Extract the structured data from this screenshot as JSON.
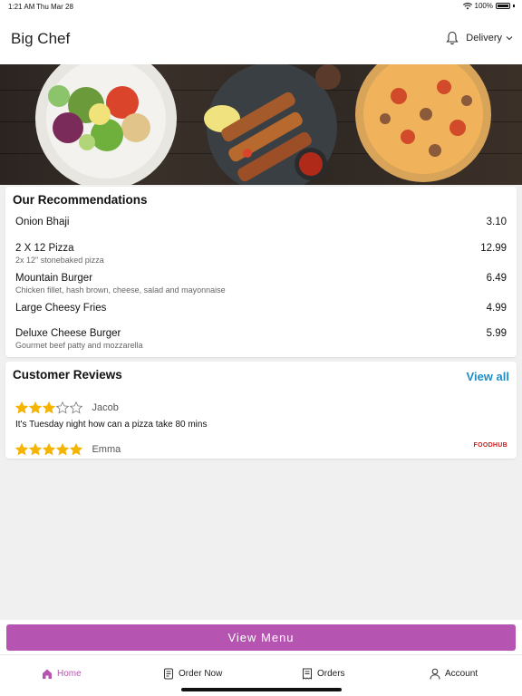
{
  "status_bar": {
    "time": "1:21 AM",
    "date": "Thu Mar 28",
    "battery": "100%"
  },
  "header": {
    "title": "Big Chef",
    "mode_label": "Delivery"
  },
  "recommendations": {
    "title": "Our Recommendations",
    "items": [
      {
        "name": "Onion Bhaji",
        "description": "",
        "price": "3.10"
      },
      {
        "name": "2 X 12 Pizza",
        "description": "2x 12\" stonebaked pizza",
        "price": "12.99"
      },
      {
        "name": "Mountain Burger",
        "description": "Chicken fillet, hash brown, cheese, salad and mayonnaise",
        "price": "6.49"
      },
      {
        "name": "Large Cheesy Fries",
        "description": "",
        "price": "4.99"
      },
      {
        "name": "Deluxe Cheese Burger",
        "description": "Gourmet beef patty and mozzarella",
        "price": "5.99"
      }
    ]
  },
  "reviews": {
    "title": "Customer Reviews",
    "view_all_label": "View all",
    "items": [
      {
        "name": "Jacob",
        "rating": 3,
        "max_rating": 5,
        "text": "It's Tuesday night how can a pizza take 80 mins"
      },
      {
        "name": "Emma",
        "rating": 5,
        "max_rating": 5,
        "text": ""
      }
    ],
    "brand": "FOODHUB"
  },
  "view_menu_label": "View Menu",
  "tabs": [
    {
      "label": "Home",
      "icon": "home-icon",
      "active": true
    },
    {
      "label": "Order Now",
      "icon": "order-icon",
      "active": false
    },
    {
      "label": "Orders",
      "icon": "receipt-icon",
      "active": false
    },
    {
      "label": "Account",
      "icon": "person-icon",
      "active": false
    }
  ],
  "colors": {
    "accent": "#b655b1",
    "link": "#1e8fc6",
    "star": "#f5b400",
    "brand_red": "#d01b1b"
  }
}
